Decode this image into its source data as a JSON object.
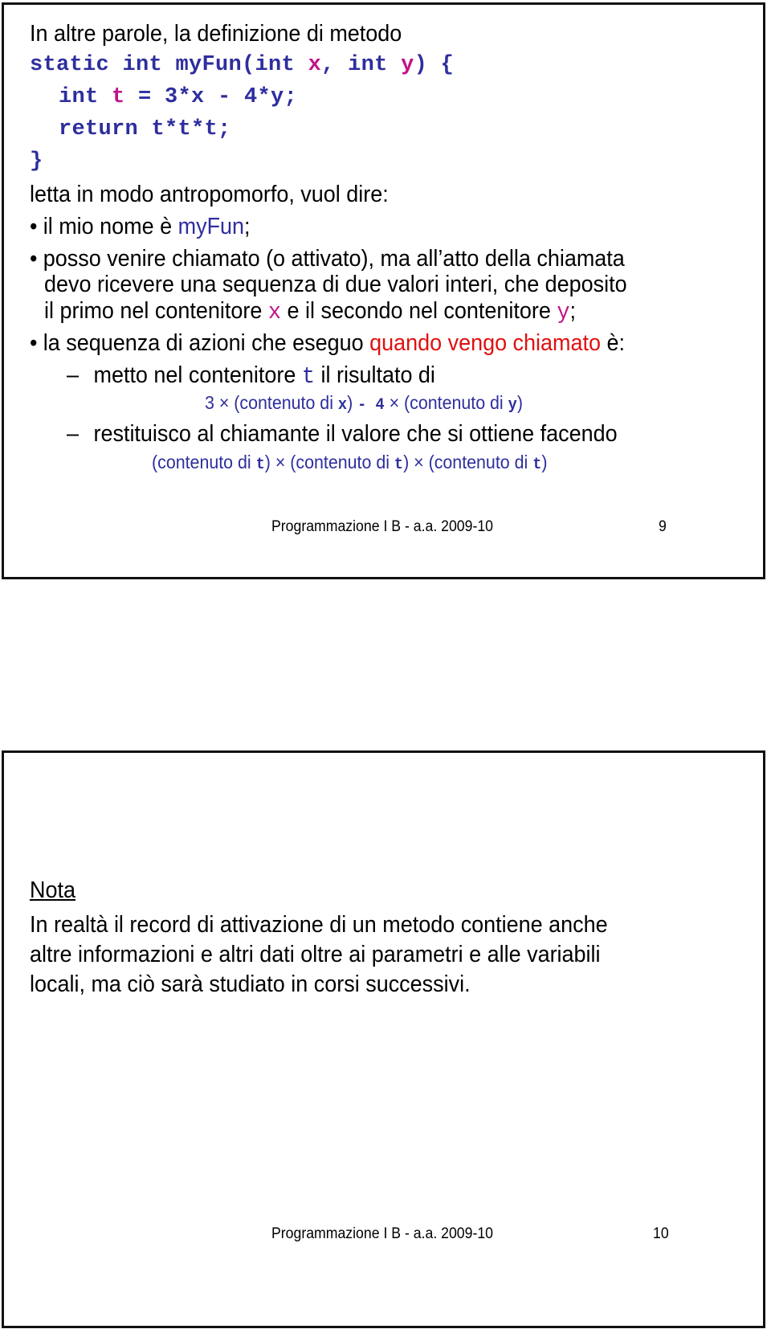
{
  "slides": [
    {
      "intro": "In altre parole, la definizione di metodo",
      "code": {
        "line1_a": "static int myFun(int ",
        "line1_x": "x",
        "line1_b": ", int ",
        "line1_y": "y",
        "line1_c": ") {",
        "line2_a": "int ",
        "line2_t": "t",
        "line2_b": " = 3*x - 4*y;",
        "line3": "return t*t*t;",
        "line4": "}"
      },
      "reading": "letta in modo antropomorfo, vuol dire:",
      "bullet_char": "•",
      "dash_char": "–",
      "bullet1": {
        "pre": "il mio nome è ",
        "name": "myFun",
        "post": ";"
      },
      "bullet2": {
        "line1": "posso venire chiamato (o attivato), ma all’atto della chiamata",
        "line2": "devo ricevere una sequenza di due valori interi, che deposito",
        "line3_a": "il primo nel contenitore ",
        "line3_x": "x",
        "line3_b": " e il secondo nel contenitore ",
        "line3_y": "y",
        "line3_c": ";"
      },
      "bullet3": {
        "pre": "la sequenza di azioni che eseguo ",
        "highlight": "quando vengo chiamato",
        "post": " è:"
      },
      "sub1": {
        "pre": "metto nel contenitore ",
        "var": "t",
        "post": " il risultato di"
      },
      "formula1": {
        "a": "3 × (contenuto di ",
        "x": "x",
        "b": ")  ",
        "minus4": "-  4",
        "c": " × (contenuto di ",
        "y": "y",
        "d": ")"
      },
      "sub2": "restituisco al chiamante il valore che si ottiene facendo",
      "formula2": {
        "a": "(contenuto di ",
        "t": "t",
        "b": ") × (contenuto di ",
        "c": ") × (contenuto di ",
        "d": ")"
      },
      "footer": {
        "course": "Programmazione I B - a.a. 2009-10",
        "page": "9"
      }
    },
    {
      "nota_title": "Nota",
      "nota_lines": [
        "In realtà il record di attivazione di un metodo contiene anche",
        "altre informazioni e altri dati oltre ai parametri e alle variabili",
        "locali, ma ciò sarà studiato in corsi successivi."
      ],
      "footer": {
        "course": "Programmazione I B - a.a. 2009-10",
        "page": "10"
      }
    }
  ],
  "colors": {
    "code_blue": "#2e2e9e",
    "variable_magenta": "#c0138a",
    "highlight_red": "#e01010"
  }
}
